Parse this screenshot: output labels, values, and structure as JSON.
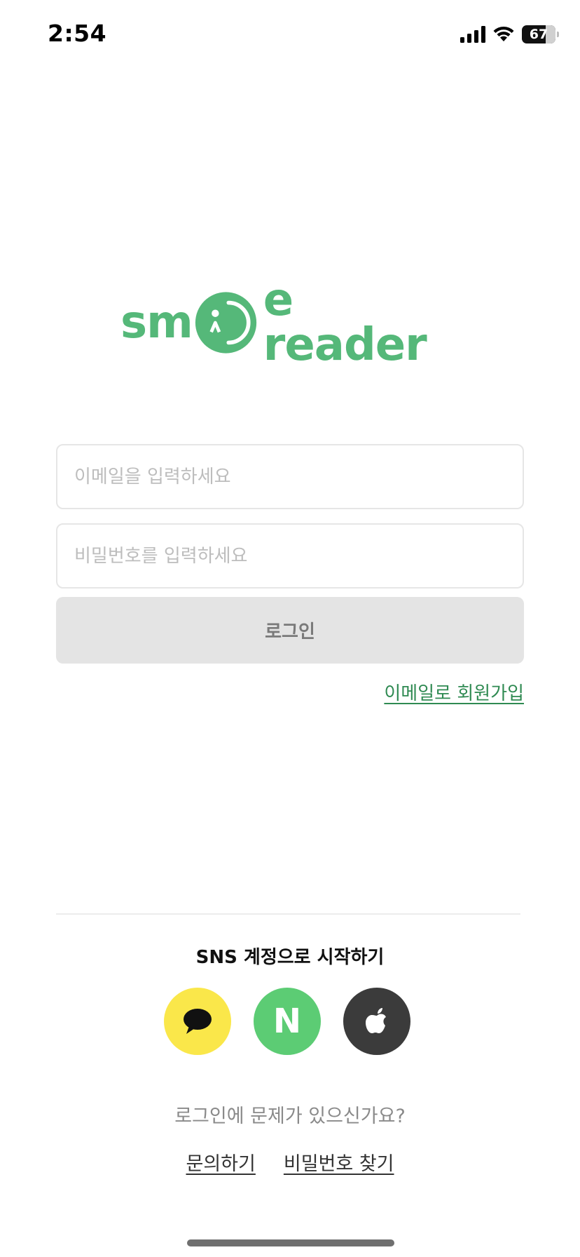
{
  "status_bar": {
    "time": "2:54",
    "battery": "67"
  },
  "logo": {
    "text_left": "sm",
    "text_right": "e reader"
  },
  "form": {
    "email_placeholder": "이메일을 입력하세요",
    "password_placeholder": "비밀번호를 입력하세요",
    "login_label": "로그인",
    "signup_label": "이메일로 회원가입"
  },
  "sns": {
    "title": "SNS 계정으로 시작하기",
    "buttons": [
      "kakao",
      "naver",
      "apple"
    ],
    "naver_letter": "N"
  },
  "help": {
    "question": "로그인에 문제가 있으신가요?",
    "contact_label": "문의하기",
    "find_password_label": "비밀번호 찾기"
  },
  "colors": {
    "brand": "#55b879",
    "link": "#2f8a52",
    "kakao": "#fae74a",
    "naver": "#5ccc74",
    "apple": "#3b3b3b"
  }
}
